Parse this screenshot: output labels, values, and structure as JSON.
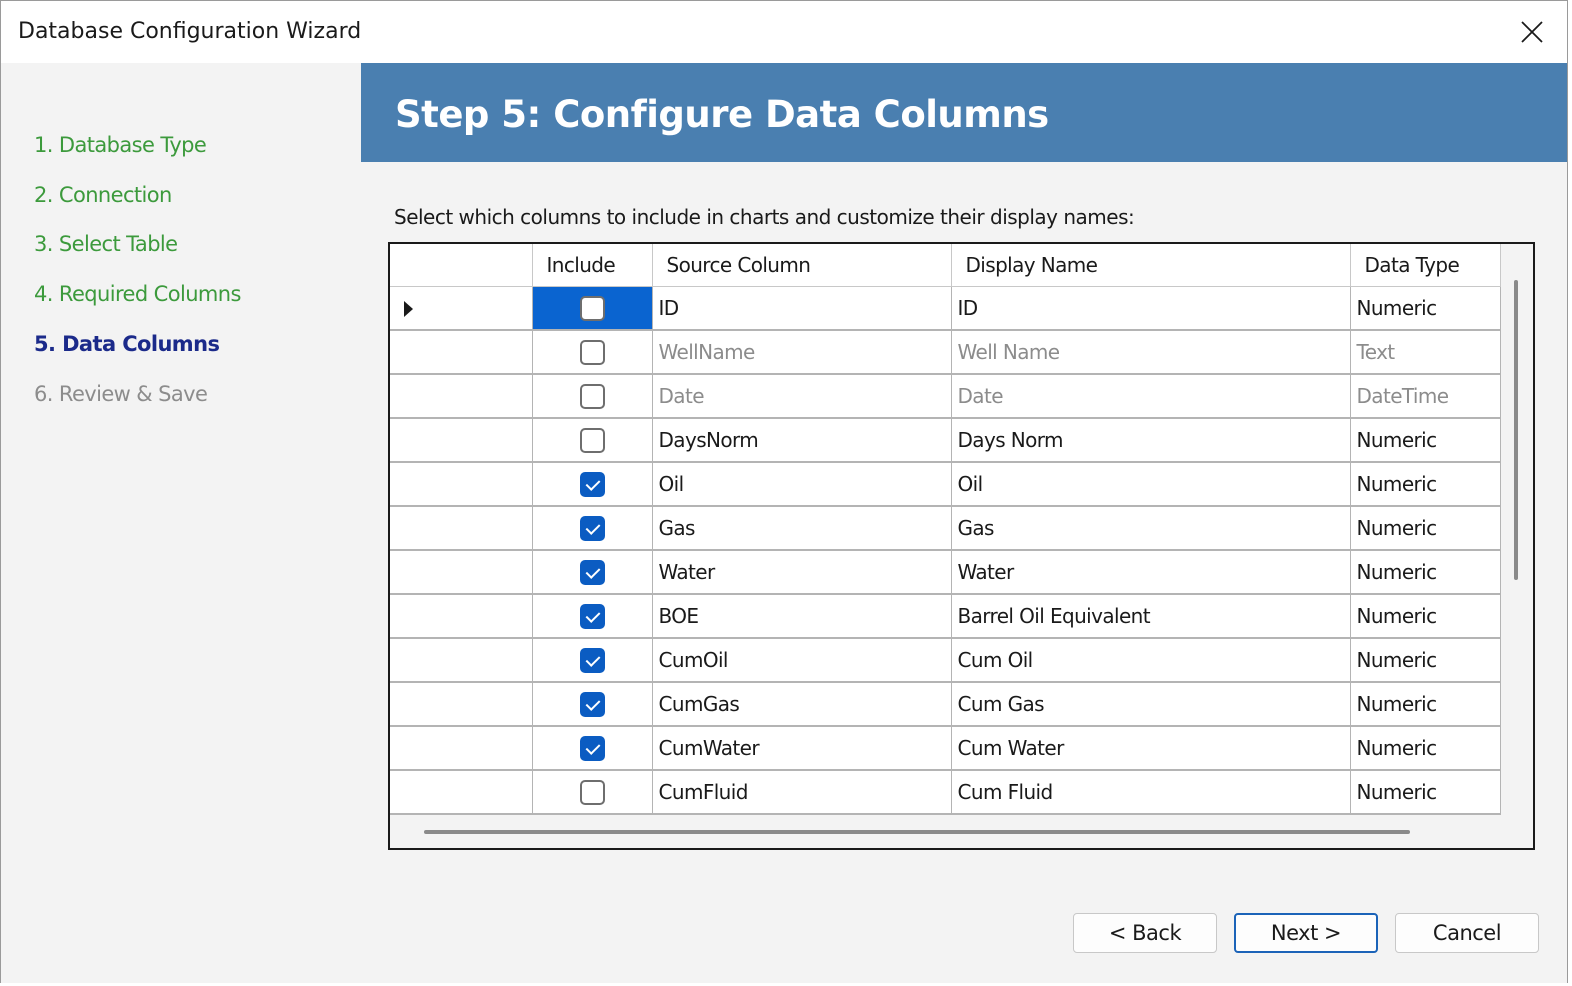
{
  "window": {
    "title": "Database Configuration Wizard"
  },
  "sidebar": {
    "steps": [
      {
        "label": "1. Database Type",
        "state": "done"
      },
      {
        "label": "2. Connection",
        "state": "done"
      },
      {
        "label": "3. Select Table",
        "state": "done"
      },
      {
        "label": "4. Required Columns",
        "state": "done"
      },
      {
        "label": "5. Data Columns",
        "state": "current"
      },
      {
        "label": "6. Review & Save",
        "state": "todo"
      }
    ]
  },
  "banner": {
    "title": "Step 5: Configure Data Columns"
  },
  "instructions": "Select which columns to include in charts and customize their display names:",
  "grid": {
    "headers": {
      "include": "Include",
      "source": "Source Column",
      "display": "Display Name",
      "type": "Data Type"
    },
    "rows": [
      {
        "include": false,
        "source": "ID",
        "display": "ID",
        "type": "Numeric",
        "readonly": false,
        "selected": true
      },
      {
        "include": false,
        "source": "WellName",
        "display": "Well Name",
        "type": "Text",
        "readonly": true,
        "selected": false
      },
      {
        "include": false,
        "source": "Date",
        "display": "Date",
        "type": "DateTime",
        "readonly": true,
        "selected": false
      },
      {
        "include": false,
        "source": "DaysNorm",
        "display": "Days Norm",
        "type": "Numeric",
        "readonly": false,
        "selected": false
      },
      {
        "include": true,
        "source": "Oil",
        "display": "Oil",
        "type": "Numeric",
        "readonly": false,
        "selected": false
      },
      {
        "include": true,
        "source": "Gas",
        "display": "Gas",
        "type": "Numeric",
        "readonly": false,
        "selected": false
      },
      {
        "include": true,
        "source": "Water",
        "display": "Water",
        "type": "Numeric",
        "readonly": false,
        "selected": false
      },
      {
        "include": true,
        "source": "BOE",
        "display": "Barrel Oil Equivalent",
        "type": "Numeric",
        "readonly": false,
        "selected": false
      },
      {
        "include": true,
        "source": "CumOil",
        "display": "Cum Oil",
        "type": "Numeric",
        "readonly": false,
        "selected": false
      },
      {
        "include": true,
        "source": "CumGas",
        "display": "Cum Gas",
        "type": "Numeric",
        "readonly": false,
        "selected": false
      },
      {
        "include": true,
        "source": "CumWater",
        "display": "Cum Water",
        "type": "Numeric",
        "readonly": false,
        "selected": false
      },
      {
        "include": false,
        "source": "CumFluid",
        "display": "Cum Fluid",
        "type": "Numeric",
        "readonly": false,
        "selected": false
      }
    ]
  },
  "buttons": {
    "back": "< Back",
    "next": "Next >",
    "cancel": "Cancel"
  },
  "colors": {
    "banner": "#4a7fb0",
    "step_done": "#3c9a3c",
    "step_current": "#1b2a8a",
    "step_todo": "#8c8c8c",
    "selection": "#0a64d0",
    "checkbox": "#0b5cc2"
  },
  "icons": {
    "close": "close-icon",
    "row_indicator": "row-indicator-icon"
  }
}
